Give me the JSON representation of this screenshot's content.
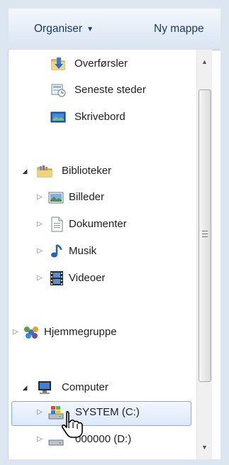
{
  "toolbar": {
    "organise_label": "Organiser",
    "organise_arrow": "▼",
    "new_folder_label": "Ny mappe"
  },
  "nav": {
    "favorites": [
      {
        "label": "Overførsler",
        "icon": "downloads-folder-icon"
      },
      {
        "label": "Seneste steder",
        "icon": "recent-places-icon"
      },
      {
        "label": "Skrivebord",
        "icon": "desktop-icon"
      }
    ],
    "libraries": {
      "label": "Biblioteker",
      "expanded": true,
      "icon": "libraries-icon",
      "items": [
        {
          "label": "Billeder",
          "icon": "pictures-icon"
        },
        {
          "label": "Dokumenter",
          "icon": "documents-icon"
        },
        {
          "label": "Musik",
          "icon": "music-icon"
        },
        {
          "label": "Videoer",
          "icon": "videos-icon"
        }
      ]
    },
    "homegroup": {
      "label": "Hjemmegruppe",
      "icon": "homegroup-icon"
    },
    "computer": {
      "label": "Computer",
      "expanded": true,
      "icon": "computer-icon",
      "items": [
        {
          "label": "SYSTEM (C:)",
          "icon": "system-drive-icon",
          "selected": true
        },
        {
          "label": "000000 (D:)",
          "icon": "drive-icon"
        }
      ]
    }
  },
  "glyphs": {
    "collapsed": "▷",
    "expanded": "◢",
    "scroll_up": "▲",
    "scroll_down": "▼"
  },
  "colors": {
    "toolbar_text": "#1a3a63",
    "selection_border": "#84acdd",
    "frame": "#dce6f1"
  }
}
